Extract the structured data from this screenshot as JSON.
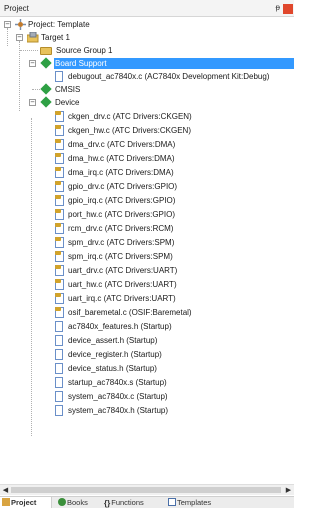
{
  "panel": {
    "title": "Project",
    "pin_glyph": "ᵽ"
  },
  "tree": {
    "project": "Project: Template",
    "target": "Target 1",
    "source_group": "Source Group 1",
    "board_support": "Board Support",
    "board_file": "debugout_ac7840x.c (AC7840x Development Kit:Debug)",
    "cmsis": "CMSIS",
    "device": "Device",
    "device_files": [
      "ckgen_drv.c (ATC Drivers:CKGEN)",
      "ckgen_hw.c (ATC Drivers:CKGEN)",
      "dma_drv.c (ATC Drivers:DMA)",
      "dma_hw.c (ATC Drivers:DMA)",
      "dma_irq.c (ATC Drivers:DMA)",
      "gpio_drv.c (ATC Drivers:GPIO)",
      "gpio_irq.c (ATC Drivers:GPIO)",
      "port_hw.c (ATC Drivers:GPIO)",
      "rcm_drv.c (ATC Drivers:RCM)",
      "spm_drv.c (ATC Drivers:SPM)",
      "spm_irq.c (ATC Drivers:SPM)",
      "uart_drv.c (ATC Drivers:UART)",
      "uart_hw.c (ATC Drivers:UART)",
      "uart_irq.c (ATC Drivers:UART)",
      "osif_baremetal.c (OSIF:Baremetal)",
      "ac7840x_features.h (Startup)",
      "device_assert.h (Startup)",
      "device_register.h (Startup)",
      "device_status.h (Startup)",
      "startup_ac7840x.s (Startup)",
      "system_ac7840x.c (Startup)",
      "system_ac7840x.h (Startup)"
    ]
  },
  "tabs": [
    "Project",
    "Books",
    "Functions",
    "Templates"
  ],
  "colors": {
    "selection": "#3399ff",
    "close_button": "#e0472c",
    "component_diamond": "#2ea044"
  }
}
